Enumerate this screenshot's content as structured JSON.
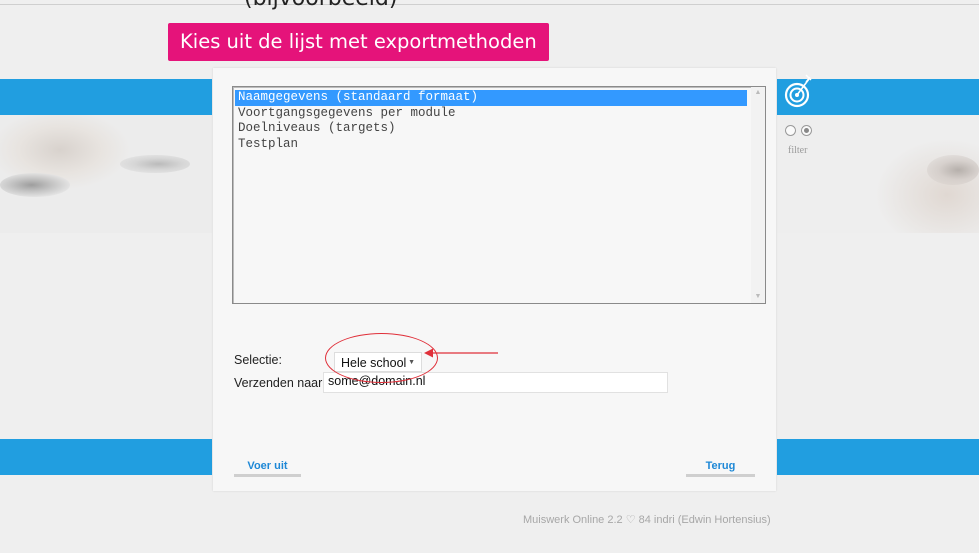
{
  "header": {
    "cut_heading": "(bijvoorbeeld)",
    "title": "Kies uit de lijst met exportmethoden"
  },
  "export_list": {
    "items": [
      {
        "label": "Naamgegevens (standaard formaat)",
        "selected": true
      },
      {
        "label": "Voortgangsgegevens per module",
        "selected": false
      },
      {
        "label": "Doelniveaus (targets)",
        "selected": false
      },
      {
        "label": "Testplan",
        "selected": false
      }
    ]
  },
  "form": {
    "selection_label": "Selectie:",
    "selection_value": "Hele school",
    "send_to_label": "Verzenden naar:",
    "send_to_value": "some@domain.nl"
  },
  "buttons": {
    "run": "Voer uit",
    "back": "Terug"
  },
  "sidebar": {
    "filter_label": "filter"
  },
  "footer": {
    "status": "Muiswerk Online 2.2  ♡ 84  indri  (Edwin Hortensius)"
  },
  "colors": {
    "accent_pink": "#e5137a",
    "band_blue": "#219ee0",
    "link_blue": "#1e88d6",
    "selection_blue": "#3399ff",
    "annotation_red": "#e0303a"
  }
}
